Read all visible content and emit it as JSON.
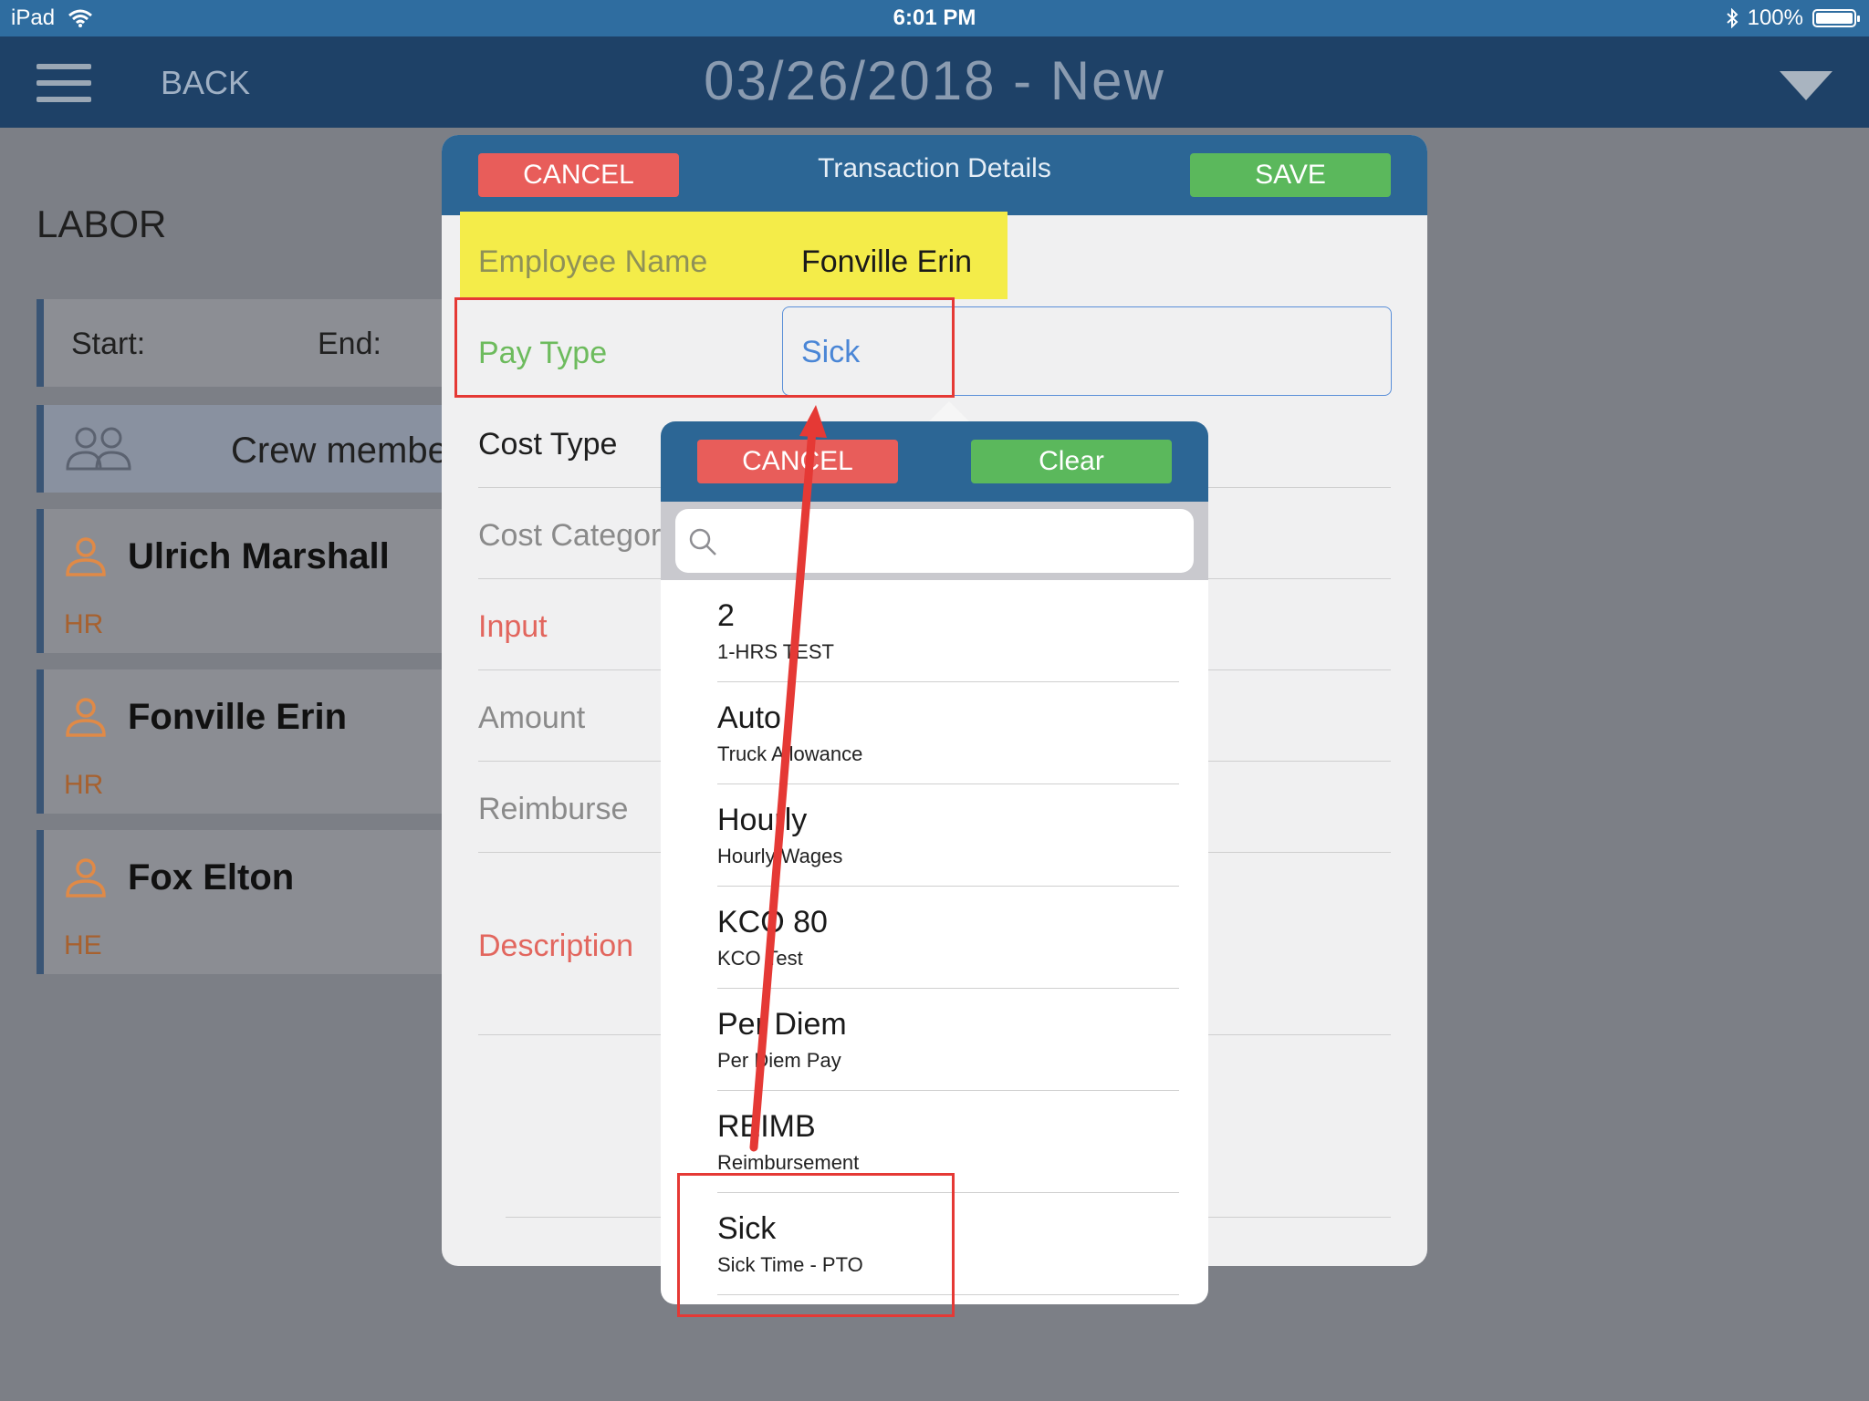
{
  "statusbar": {
    "device": "iPad",
    "time": "6:01 PM",
    "battery": "100%"
  },
  "navbar": {
    "back": "BACK",
    "title": "03/26/2018 - New"
  },
  "labor": {
    "title": "LABOR",
    "start_label": "Start:",
    "end_label": "End:",
    "crew_label": "Crew member",
    "employees": [
      {
        "name": "Ulrich Marshall",
        "dept": "HR"
      },
      {
        "name": "Fonville Erin",
        "dept": "HR"
      },
      {
        "name": "Fox Elton",
        "dept": "HE"
      }
    ]
  },
  "modal": {
    "cancel": "CANCEL",
    "title": "Transaction Details",
    "save": "SAVE",
    "employee_name_label": "Employee Name",
    "employee_name_value": "Fonville Erin",
    "pay_type_label": "Pay Type",
    "pay_type_value": "Sick",
    "cost_type_label": "Cost Type",
    "cost_category_label": "Cost Category",
    "input_label": "Input",
    "amount_label": "Amount",
    "reimburse_label": "Reimburse",
    "description_label": "Description"
  },
  "popover": {
    "cancel": "CANCEL",
    "clear": "Clear",
    "search_placeholder": "",
    "items": [
      {
        "title": "2",
        "sub": "1-HRS TEST"
      },
      {
        "title": "Auto",
        "sub": "Truck Allowance"
      },
      {
        "title": "Hourly",
        "sub": "Hourly Wages"
      },
      {
        "title": "KCO 80",
        "sub": "KCO Test"
      },
      {
        "title": "Per Diem",
        "sub": "Per Diem Pay"
      },
      {
        "title": "REIMB",
        "sub": "Reimbursement"
      },
      {
        "title": "Sick",
        "sub": "Sick Time - PTO"
      }
    ]
  },
  "colors": {
    "status_bar": "#2f6da0",
    "nav_bar": "#1e4167",
    "cancel_red": "#e85d5a",
    "save_green": "#5bb85c",
    "highlight_yellow": "#f4ec49",
    "annotation_red": "#e53935"
  }
}
